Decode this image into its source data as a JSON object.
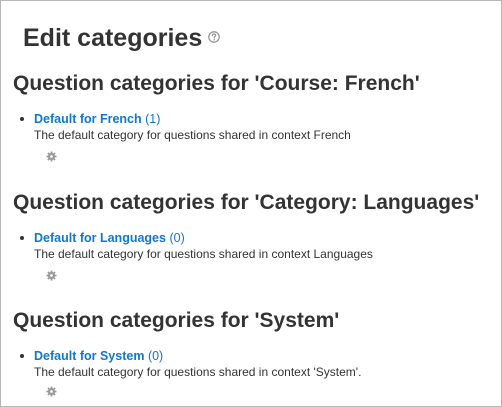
{
  "page": {
    "title": "Edit categories"
  },
  "sections": [
    {
      "heading": "Question categories for 'Course: French'",
      "category": {
        "link": "Default for French",
        "count": "(1)",
        "description": "The default category for questions shared in context French"
      }
    },
    {
      "heading": "Question categories for 'Category: Languages'",
      "category": {
        "link": "Default for Languages",
        "count": "(0)",
        "description": "The default category for questions shared in context Languages"
      }
    },
    {
      "heading": "Question categories for 'System'",
      "category": {
        "link": "Default for System",
        "count": "(0)",
        "description": "The default category for questions shared in context 'System'."
      }
    }
  ],
  "icons": {
    "help": "help-icon",
    "edit": "gear-icon"
  },
  "colors": {
    "link": "#1177d1",
    "text": "#333333",
    "icon": "#999999"
  }
}
